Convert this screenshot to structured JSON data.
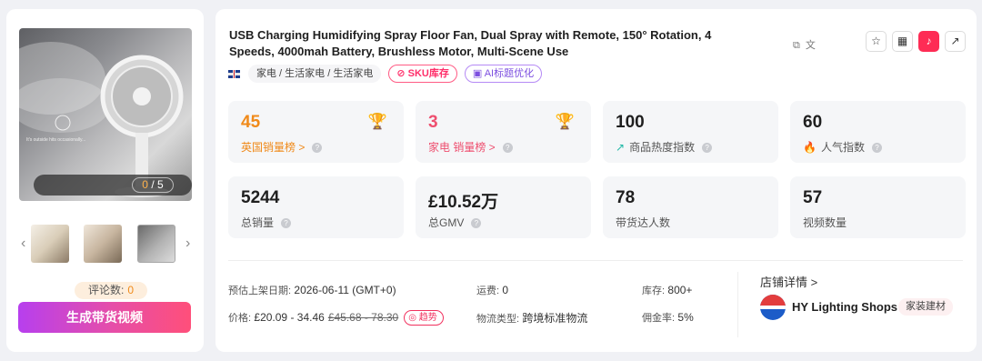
{
  "product": {
    "title": "USB Charging Humidifying Spray Floor Fan, Dual Spray with Remote, 150° Rotation, 4 Speeds, 4000mah Battery, Brushless Motor, Multi-Scene Use",
    "category": "家电 / 生活家电 / 生活家电",
    "sku_tag": "SKU库存",
    "ai_tag": "AI标题优化"
  },
  "gallery": {
    "current": "0",
    "separator": "/",
    "total": "5",
    "review_label": "评论数:",
    "review_count": "0"
  },
  "generate_button": "生成带货视频",
  "stats": {
    "uk_rank": {
      "value": "45",
      "label": "英国销量榜 >"
    },
    "cat_rank": {
      "value": "3",
      "label": "家电 销量榜 >"
    },
    "heat_index": {
      "value": "100",
      "label": "商品热度指数"
    },
    "popularity": {
      "value": "60",
      "label": "人气指数"
    },
    "total_sales": {
      "value": "5244",
      "label": "总销量"
    },
    "total_gmv": {
      "value": "£10.52万",
      "label": "总GMV"
    },
    "creators": {
      "value": "78",
      "label": "带货达人数"
    },
    "videos": {
      "value": "57",
      "label": "视频数量"
    }
  },
  "meta": {
    "listing_date_label": "预估上架日期:",
    "listing_date": "2026-06-11 (GMT+0)",
    "shipping_label": "运费:",
    "shipping": "0",
    "stock_label": "库存:",
    "stock": "800+",
    "price_label": "价格:",
    "price": "£20.09 - 34.46",
    "original_price": "£45.68 - 78.30",
    "trend_label": "趋势",
    "logistics_label": "物流类型:",
    "logistics": "跨境标准物流",
    "commission_label": "佣金率:",
    "commission": "5%"
  },
  "shop": {
    "link": "店铺详情 >",
    "name": "HY Lighting Shops",
    "badge": "家装建材"
  }
}
